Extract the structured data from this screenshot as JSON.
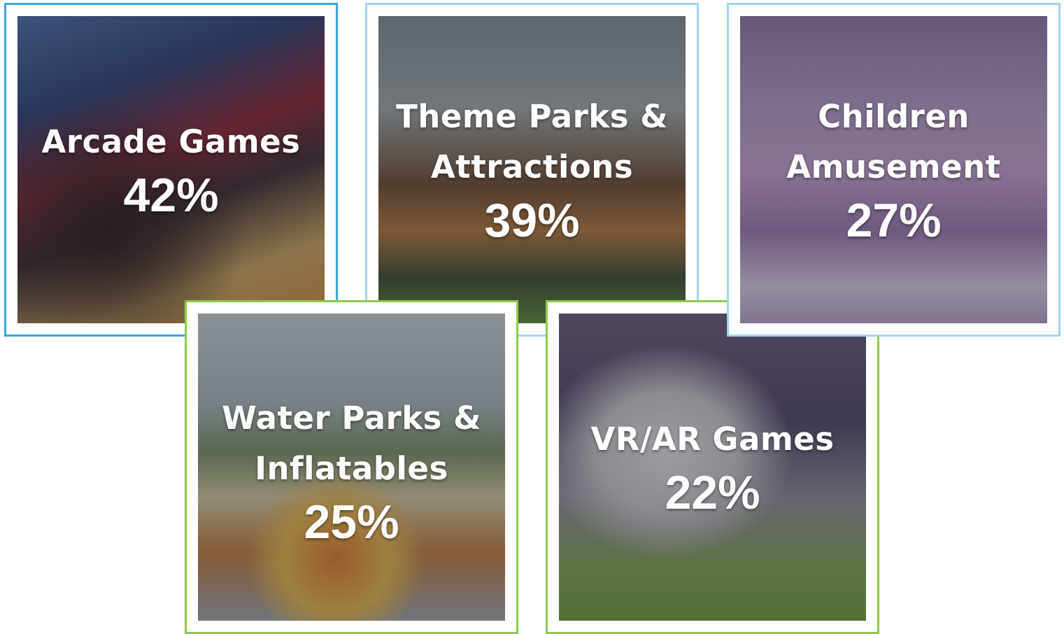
{
  "tiles": [
    {
      "label_line1": "Arcade Games",
      "label_line2": "",
      "value": "42%",
      "border_color": "#3aa6d8"
    },
    {
      "label_line1": "Theme Parks &",
      "label_line2": "Attractions",
      "value": "39%",
      "border_color": "#9fd3ef"
    },
    {
      "label_line1": "Children",
      "label_line2": "Amusement",
      "value": "27%",
      "border_color": "#9fd3ef"
    },
    {
      "label_line1": "Water Parks &",
      "label_line2": "Inflatables",
      "value": "25%",
      "border_color": "#8ccb4a"
    },
    {
      "label_line1": "VR/AR Games",
      "label_line2": "",
      "value": "22%",
      "border_color": "#8ccb4a"
    }
  ]
}
